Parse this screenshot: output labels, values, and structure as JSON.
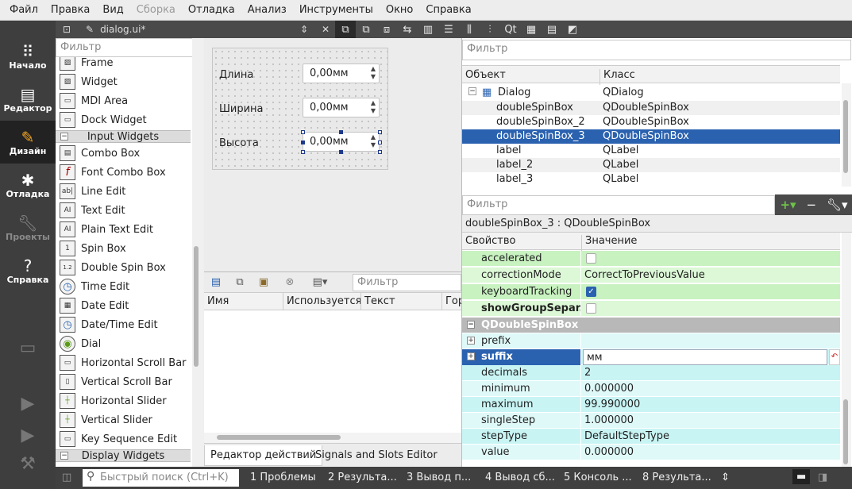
{
  "menu": [
    "Файл",
    "Правка",
    "Вид",
    "Сборка",
    "Отладка",
    "Анализ",
    "Инструменты",
    "Окно",
    "Справка"
  ],
  "menu_disabled": "Сборка",
  "modes": [
    {
      "label": "Начало",
      "icon": "grid-icon"
    },
    {
      "label": "Редактор",
      "icon": "document-icon"
    },
    {
      "label": "Дизайн",
      "icon": "pencil-icon"
    },
    {
      "label": "Отладка",
      "icon": "bug-icon"
    },
    {
      "label": "Проекты",
      "icon": "wrench-icon"
    },
    {
      "label": "Справка",
      "icon": "help-icon"
    }
  ],
  "toolbar": {
    "document": "dialog.ui*"
  },
  "widgetbox": {
    "filter_placeholder": "Фильтр",
    "items_top": [
      "Frame",
      "Widget",
      "MDI Area",
      "Dock Widget"
    ],
    "category_input": "Input Widgets",
    "input_items": [
      {
        "label": "Combo Box",
        "glyph": "▤"
      },
      {
        "label": "Font Combo Box",
        "glyph": "f"
      },
      {
        "label": "Line Edit",
        "glyph": "ab|"
      },
      {
        "label": "Text Edit",
        "glyph": "AI"
      },
      {
        "label": "Plain Text Edit",
        "glyph": "AI"
      },
      {
        "label": "Spin Box",
        "glyph": "1"
      },
      {
        "label": "Double Spin Box",
        "glyph": "1.2"
      },
      {
        "label": "Time Edit",
        "glyph": "◷"
      },
      {
        "label": "Date Edit",
        "glyph": "▦"
      },
      {
        "label": "Date/Time Edit",
        "glyph": "◷"
      },
      {
        "label": "Dial",
        "glyph": "◉"
      },
      {
        "label": "Horizontal Scroll Bar",
        "glyph": "▭"
      },
      {
        "label": "Vertical Scroll Bar",
        "glyph": "▯"
      },
      {
        "label": "Horizontal Slider",
        "glyph": "┼"
      },
      {
        "label": "Vertical Slider",
        "glyph": "┼"
      },
      {
        "label": "Key Sequence Edit",
        "glyph": "▭"
      }
    ],
    "category_display": "Display Widgets"
  },
  "form": {
    "rows": [
      {
        "label": "Длина",
        "value": "0,00мм"
      },
      {
        "label": "Ширина",
        "value": "0,00мм"
      },
      {
        "label": "Высота",
        "value": "0,00мм"
      }
    ]
  },
  "action_editor": {
    "filter_placeholder": "Фильтр",
    "columns": [
      "Имя",
      "Используется",
      "Текст",
      "Гор"
    ]
  },
  "bottom_tabs": [
    "Редактор действий",
    "Signals and Slots Editor"
  ],
  "object_inspector": {
    "filter_placeholder": "Фильтр",
    "columns": [
      "Объект",
      "Класс"
    ],
    "rows": [
      {
        "object": "Dialog",
        "class": "QDialog"
      },
      {
        "object": "doubleSpinBox",
        "class": "QDoubleSpinBox"
      },
      {
        "object": "doubleSpinBox_2",
        "class": "QDoubleSpinBox"
      },
      {
        "object": "doubleSpinBox_3",
        "class": "QDoubleSpinBox"
      },
      {
        "object": "label",
        "class": "QLabel"
      },
      {
        "object": "label_2",
        "class": "QLabel"
      },
      {
        "object": "label_3",
        "class": "QLabel"
      }
    ],
    "selected": "doubleSpinBox_3"
  },
  "property_editor": {
    "filter_placeholder": "Фильтр",
    "title": "doubleSpinBox_3 : QDoubleSpinBox",
    "columns": [
      "Свойство",
      "Значение"
    ],
    "rows": [
      {
        "name": "accelerated",
        "value": "",
        "checkbox": "off"
      },
      {
        "name": "correctionMode",
        "value": "CorrectToPreviousValue"
      },
      {
        "name": "keyboardTracking",
        "value": "",
        "checkbox": "on"
      },
      {
        "name": "showGroupSepar...",
        "value": "",
        "checkbox": "off"
      },
      {
        "name": "QDoubleSpinBox",
        "value": ""
      },
      {
        "name": "prefix",
        "value": ""
      },
      {
        "name": "suffix",
        "value": "мм"
      },
      {
        "name": "decimals",
        "value": "2"
      },
      {
        "name": "minimum",
        "value": "0.000000"
      },
      {
        "name": "maximum",
        "value": "99.990000"
      },
      {
        "name": "singleStep",
        "value": "1.000000"
      },
      {
        "name": "stepType",
        "value": "DefaultStepType"
      },
      {
        "name": "value",
        "value": "0.000000"
      }
    ]
  },
  "statusbar": {
    "search_placeholder": "Быстрый поиск (Ctrl+K)",
    "items": [
      "1 Проблемы",
      "2 Результа...",
      "3 Вывод п...",
      "4 Вывод сб...",
      "5 Консоль ...",
      "8 Результа..."
    ]
  }
}
